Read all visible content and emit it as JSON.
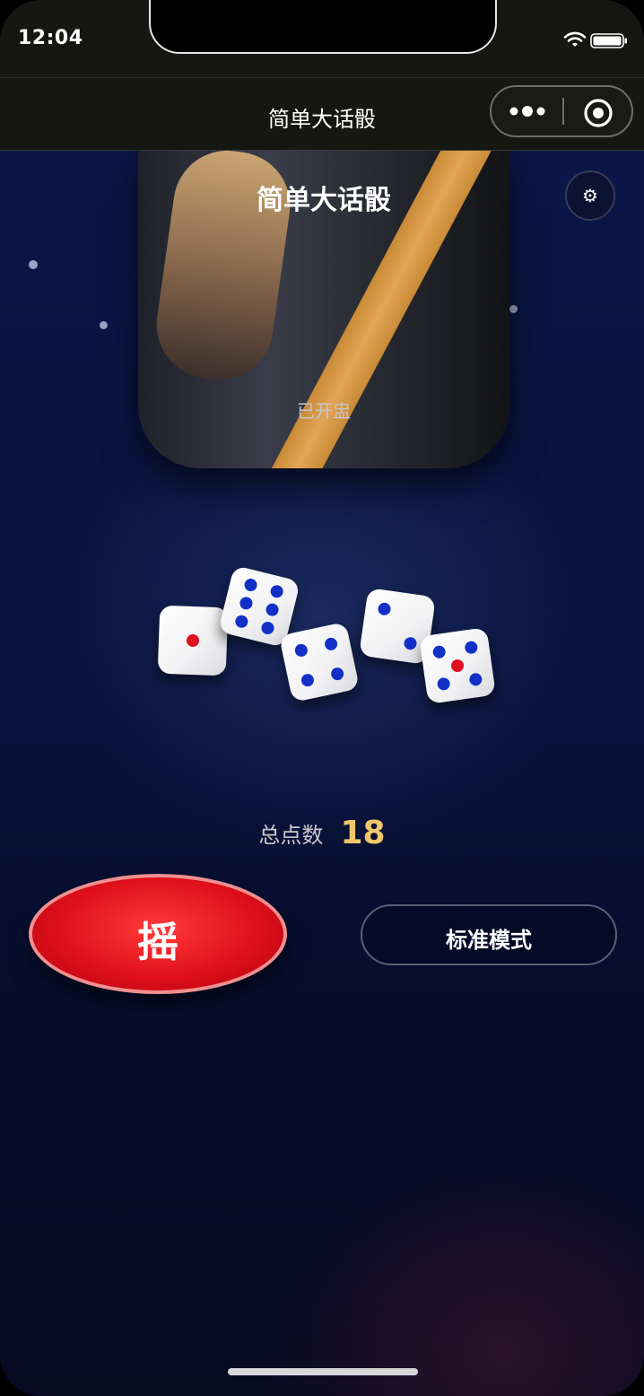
{
  "status_bar": {
    "time": "12:04"
  },
  "nav": {
    "title": "简单大话骰"
  },
  "cup": {
    "title": "简单大话骰",
    "status": "已开盅"
  },
  "settings": {
    "icon": "gear-icon",
    "glyph": "⚙"
  },
  "dice": [
    {
      "value": 1
    },
    {
      "value": 6
    },
    {
      "value": 4
    },
    {
      "value": 2
    },
    {
      "value": 5
    }
  ],
  "total": {
    "label": "总点数",
    "value": "18"
  },
  "buttons": {
    "shake": "摇",
    "mode": "标准模式"
  },
  "colors": {
    "pip_blue": "#1230c8",
    "pip_red": "#e01020",
    "total_gold": "#f0c66a",
    "shake_red": "#e0101a"
  }
}
